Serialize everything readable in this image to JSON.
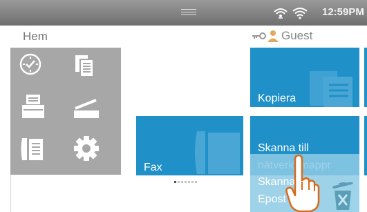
{
  "status": {
    "time": "12:59PM",
    "icons": [
      "wifi-direct-icon",
      "wifi-icon"
    ]
  },
  "home": {
    "title": "Hem"
  },
  "user": {
    "name": "Guest",
    "icons": [
      "key-icon",
      "person-icon"
    ]
  },
  "dock": {
    "icons": [
      "job-status-icon",
      "documents-icon",
      "printer-icon",
      "scanner-icon",
      "address-book-icon",
      "settings-gear-icon"
    ]
  },
  "tiles": {
    "copy_label": "Kopiera",
    "fax_label": "Fax",
    "scan_network_label": "Skanna till nätverksmappr",
    "scan_email_label": "Skanna till Epost"
  },
  "pager": {
    "pages": 7,
    "active": 1
  },
  "colors": {
    "tile_blue": "#1f90c8",
    "dock_gray": "#a7a7a7",
    "status_gray": "#7f7f7f"
  }
}
